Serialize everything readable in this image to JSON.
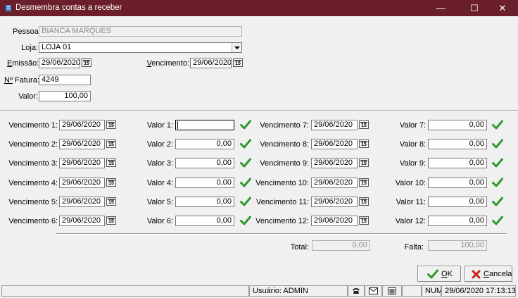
{
  "window": {
    "title": "Desmembra contas a receber",
    "minimize": "—",
    "maximize": "☐",
    "close": "✕"
  },
  "header": {
    "pessoa_label": "Pessoa:",
    "pessoa_value": "BIANCA MARQUES",
    "loja_label": "Loja:",
    "loja_value": "LOJA 01",
    "emissao_label_u": "E",
    "emissao_label_rest": "missão:",
    "emissao_value": "29/06/2020",
    "vencimento_label_u": "V",
    "vencimento_label_rest": "encimento:",
    "vencimento_value": "29/06/2020",
    "fatura_label_u": "Nº",
    "fatura_label_rest": " Fatura:",
    "fatura_value": "4249",
    "valor_label": "Valor:",
    "valor_value": "100,00"
  },
  "cal_icon_text": "15",
  "installments_left": [
    {
      "venc_label": "Vencimento 1:",
      "venc_value": "29/06/2020",
      "valor_label": "Valor 1:",
      "valor_value": ""
    },
    {
      "venc_label": "Vencimento 2:",
      "venc_value": "29/06/2020",
      "valor_label": "Valor 2:",
      "valor_value": "0,00"
    },
    {
      "venc_label": "Vencimento 3:",
      "venc_value": "29/06/2020",
      "valor_label": "Valor 3:",
      "valor_value": "0,00"
    },
    {
      "venc_label": "Vencimento 4:",
      "venc_value": "29/06/2020",
      "valor_label": "Valor 4:",
      "valor_value": "0,00"
    },
    {
      "venc_label": "Vencimento 5:",
      "venc_value": "29/06/2020",
      "valor_label": "Valor 5:",
      "valor_value": "0,00"
    },
    {
      "venc_label": "Vencimento 6:",
      "venc_value": "29/06/2020",
      "valor_label": "Valor 6:",
      "valor_value": "0,00"
    }
  ],
  "installments_right": [
    {
      "venc_label": "Vencimento 7:",
      "venc_value": "29/06/2020",
      "valor_label": "Valor 7:",
      "valor_value": "0,00"
    },
    {
      "venc_label": "Vencimento 8:",
      "venc_value": "29/06/2020",
      "valor_label": "Valor 8:",
      "valor_value": "0,00"
    },
    {
      "venc_label": "Vencimento 9:",
      "venc_value": "29/06/2020",
      "valor_label": "Valor 9:",
      "valor_value": "0,00"
    },
    {
      "venc_label": "Vencimento 10:",
      "venc_value": "29/06/2020",
      "valor_label": "Valor 10:",
      "valor_value": "0,00"
    },
    {
      "venc_label": "Vencimento 11:",
      "venc_value": "29/06/2020",
      "valor_label": "Valor 11:",
      "valor_value": "0,00"
    },
    {
      "venc_label": "Vencimento 12:",
      "venc_value": "29/06/2020",
      "valor_label": "Valor 12:",
      "valor_value": "0,00"
    }
  ],
  "totals": {
    "total_label": "Total:",
    "total_value": "0,00",
    "falta_label": "Falta:",
    "falta_value": "100,00"
  },
  "buttons": {
    "ok_u": "O",
    "ok_rest": "K",
    "cancel_u": "C",
    "cancel_rest": "ancela"
  },
  "statusbar": {
    "usuario": "Usuário: ADMIN",
    "num": "NUM",
    "datetime": "29/06/2020 17:13:13"
  },
  "colors": {
    "titlebar": "#6b1f2a",
    "check": "#2e9a2e",
    "cancel_x": "#cc1f1f"
  }
}
